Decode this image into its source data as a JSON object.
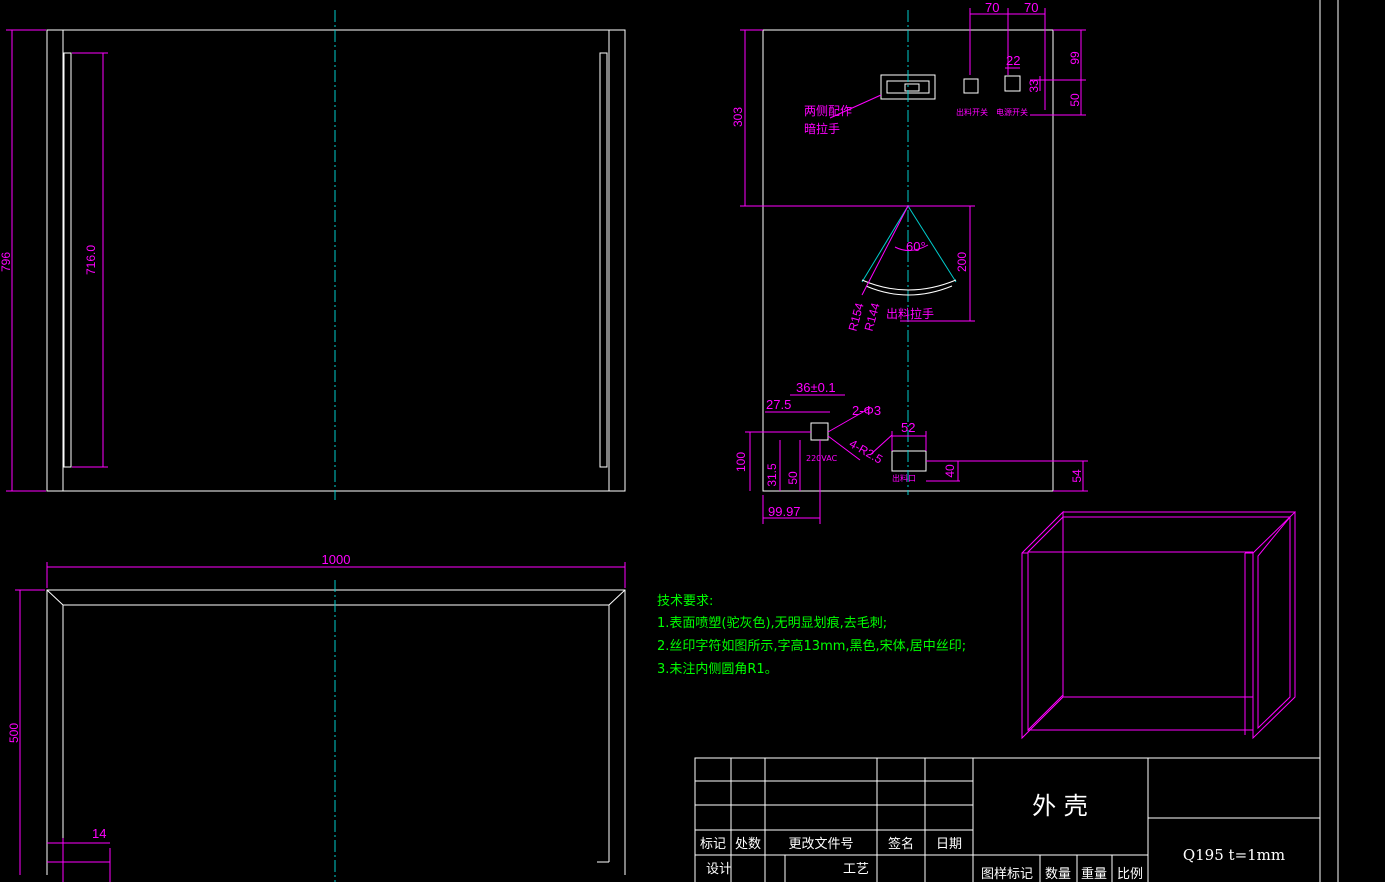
{
  "drawing": {
    "front_view": {
      "dim_height": "796",
      "dim_inner": "716.0"
    },
    "top_view": {
      "dim_width": "1000",
      "dim_depth": "500",
      "dim_flange": "14"
    },
    "side_view": {
      "dim_70a": "70",
      "dim_70b": "70",
      "dim_99": "99",
      "dim_22": "22",
      "dim_33": "33",
      "dim_50top": "50",
      "dim_303": "303",
      "dim_200": "200",
      "angle": "60°",
      "r154": "R154",
      "r144": "R144",
      "dim_36": "36±0.1",
      "dim_275": "27.5",
      "dim_2phi3": "2-Φ3",
      "dim_4r": "4-R2.5",
      "dim_52": "52",
      "dim_100": "100",
      "dim_315": "31.5",
      "dim_50bot": "50",
      "dim_40": "40",
      "dim_54": "54",
      "dim_9997": "99.97",
      "voltage": "220VAC",
      "label_handle_1": "两侧配作",
      "label_handle_2": "暗拉手",
      "label_switch_out": "出料开关",
      "label_switch_power": "电源开关",
      "label_out_handle": "出料拉手",
      "label_outlet": "出料口"
    },
    "tech_requirements": {
      "heading": "技术要求:",
      "line1": "1.表面喷塑(驼灰色),无明显划痕,去毛刺;",
      "line2": "2.丝印字符如图所示,字高13mm,黑色,宋体,居中丝印;",
      "line3": "3.未注内侧圆角R1。"
    },
    "title_block": {
      "part_name": "外  壳",
      "material": "Q195  t=1mm",
      "h_mark": "标记",
      "h_count": "处数",
      "h_doc": "更改文件号",
      "h_sign": "签名",
      "h_date": "日期",
      "h_design": "设计",
      "h_process": "工艺",
      "h_sample": "图样标记",
      "h_qty": "数量",
      "h_weight": "重量",
      "h_scale": "比例"
    }
  },
  "colors": {
    "outline": "#ffffff",
    "dimension": "#ff00ff",
    "centerline": "#00cccc",
    "notes": "#00ff00"
  }
}
